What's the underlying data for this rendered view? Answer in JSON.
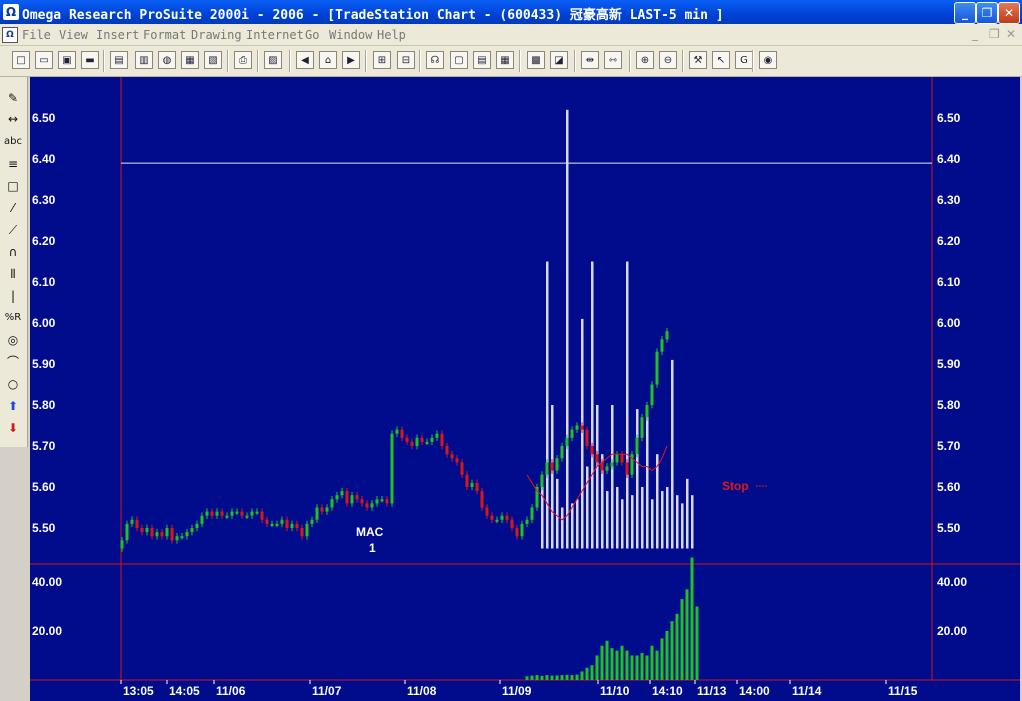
{
  "window": {
    "title": "Omega Research ProSuite 2000i - 2006 - [TradeStation Chart - (600433) 冠豪高新 LAST-5 min ]",
    "app_icon": "Ω",
    "minimize_glyph": "_",
    "maximize_glyph": "❐",
    "close_glyph": "✕"
  },
  "menu": {
    "items": [
      "File",
      "View",
      "Insert",
      "Format",
      "Drawing",
      "Internet",
      "Go",
      "Window",
      "Help"
    ],
    "mdi_minimize": "_",
    "mdi_restore": "❐",
    "mdi_close": "✕"
  },
  "toolbar_icons": [
    "new-icon",
    "open-icon",
    "save-all-icon",
    "folder-icon",
    "window-icon",
    "chart-icon",
    "globe-icon",
    "chart-analysis-icon",
    "data-icon",
    "print-icon",
    "properties-icon",
    "back-icon",
    "home-icon",
    "forward-icon",
    "insert-indicator-icon",
    "insert-study-icon",
    "expert-icon",
    "symbol-icon",
    "grid-icon",
    "table-icon",
    "bar-style-icon",
    "zoom-style-icon",
    "compress-icon",
    "expand-icon",
    "zoom-in-icon",
    "zoom-out-icon",
    "tools-icon",
    "pointer-icon",
    "goto-icon",
    "cap-icon"
  ],
  "drawing_tools": [
    {
      "name": "pencil-tool",
      "glyph": "✎"
    },
    {
      "name": "horizontal-line-tool",
      "glyph": "↔"
    },
    {
      "name": "text-tool",
      "glyph": "abc"
    },
    {
      "name": "lines-tool",
      "glyph": "≡"
    },
    {
      "name": "rectangle-tool",
      "glyph": "□"
    },
    {
      "name": "trendline-tool",
      "glyph": "⁄"
    },
    {
      "name": "fan-tool",
      "glyph": "⟋"
    },
    {
      "name": "arc-tool",
      "glyph": "∩"
    },
    {
      "name": "vertical-lines-tool",
      "glyph": "⦀"
    },
    {
      "name": "vertical-line-tool",
      "glyph": "|"
    },
    {
      "name": "percent-retracement-tool",
      "glyph": "%R"
    },
    {
      "name": "spiral-tool",
      "glyph": "◎"
    },
    {
      "name": "curve-tool",
      "glyph": "⌒"
    },
    {
      "name": "ellipse-tool",
      "glyph": "○"
    },
    {
      "name": "buy-arrow-tool",
      "glyph": "⬆"
    },
    {
      "name": "sell-arrow-tool",
      "glyph": "⬇"
    }
  ],
  "colors": {
    "chart_bg": "#000c8c",
    "axis_line": "#d21414",
    "up_bar": "#22c023",
    "down_bar": "#d81818",
    "volume": "#22c023",
    "histogram": "#d8d8f0",
    "ma_line": "#e01818",
    "hline": "#e8e8e8"
  },
  "chart_data": {
    "type": "candlestick",
    "price_axis": {
      "ticks": [
        "6.50",
        "6.40",
        "6.30",
        "6.20",
        "6.10",
        "6.00",
        "5.90",
        "5.80",
        "5.70",
        "5.60",
        "5.50"
      ],
      "ylim": [
        5.43,
        6.59
      ]
    },
    "volume_axis": {
      "ticks": [
        "40.00",
        "20.00"
      ],
      "ylim": [
        0,
        52
      ]
    },
    "time_labels": [
      "13:05",
      "14:05",
      "11/06",
      "11/07",
      "11/08",
      "11/09",
      "11/10",
      "14:10",
      "11/13",
      "14:00",
      "11/14",
      "11/15"
    ],
    "horizontal_line": 6.39,
    "annotations": [
      {
        "text": "MAC",
        "sub": "1",
        "bar": 48
      },
      {
        "text": "Stop",
        "bar": 128
      }
    ],
    "prices": [
      5.47,
      5.51,
      5.52,
      5.5,
      5.49,
      5.5,
      5.48,
      5.49,
      5.48,
      5.5,
      5.47,
      5.48,
      5.48,
      5.49,
      5.5,
      5.51,
      5.53,
      5.54,
      5.53,
      5.54,
      5.53,
      5.53,
      5.54,
      5.54,
      5.53,
      5.53,
      5.54,
      5.54,
      5.52,
      5.51,
      5.51,
      5.51,
      5.52,
      5.5,
      5.51,
      5.5,
      5.48,
      5.51,
      5.52,
      5.55,
      5.54,
      5.55,
      5.57,
      5.58,
      5.59,
      5.56,
      5.58,
      5.57,
      5.56,
      5.55,
      5.56,
      5.57,
      5.57,
      5.56,
      5.73,
      5.74,
      5.72,
      5.71,
      5.7,
      5.72,
      5.71,
      5.71,
      5.72,
      5.73,
      5.7,
      5.68,
      5.67,
      5.66,
      5.63,
      5.6,
      5.61,
      5.59,
      5.55,
      5.53,
      5.52,
      5.52,
      5.53,
      5.52,
      5.5,
      5.48,
      5.51,
      5.52,
      5.55,
      5.6,
      5.63,
      5.66,
      5.64,
      5.67,
      5.7,
      5.72,
      5.74,
      5.75,
      5.74,
      5.7,
      5.68,
      5.66,
      5.64,
      5.65,
      5.66,
      5.68,
      5.66,
      5.63,
      5.68,
      5.72,
      5.77,
      5.8,
      5.85,
      5.93,
      5.96,
      5.98
    ],
    "ma": [
      5.63,
      5.61,
      5.59,
      5.58,
      5.56,
      5.54,
      5.53,
      5.52,
      5.53,
      5.55,
      5.57,
      5.59,
      5.61,
      5.63,
      5.65,
      5.66,
      5.67,
      5.68,
      5.68,
      5.68,
      5.68,
      5.67,
      5.66,
      5.65,
      5.65,
      5.64,
      5.65,
      5.67,
      5.7
    ],
    "ma_start_bar": 81,
    "histogram": [
      0,
      0,
      0,
      5.6,
      6.15,
      5.8,
      5.62,
      5.55,
      6.52,
      5.56,
      5.57,
      6.01,
      5.65,
      6.15,
      5.8,
      5.68,
      5.59,
      5.8,
      5.6,
      5.57,
      6.15,
      5.58,
      5.79,
      5.6,
      5.8,
      5.57,
      5.68,
      5.59,
      5.6,
      5.91,
      5.58,
      5.56,
      5.62,
      5.58
    ],
    "histogram_start_bar": 81,
    "volumes": [
      0,
      0,
      0,
      0,
      0,
      0,
      0,
      0,
      0,
      0,
      0,
      0,
      0,
      0,
      0,
      0,
      0,
      0,
      0,
      0,
      0,
      0,
      0,
      0,
      0,
      0,
      0,
      0,
      0,
      0,
      0,
      0,
      0,
      0,
      0,
      0,
      0,
      0,
      0,
      0,
      0,
      0,
      0,
      0,
      0,
      0,
      0,
      0,
      0,
      0,
      0,
      0,
      0,
      0,
      0,
      0,
      0,
      0,
      0,
      0,
      0,
      0,
      0,
      0,
      0,
      0,
      0,
      0,
      0,
      0,
      0,
      0,
      0,
      0,
      0,
      0,
      0,
      0,
      0,
      0,
      0,
      1.5,
      1.8,
      2.0,
      1.7,
      2.0,
      1.8,
      1.9,
      2.0,
      2.1,
      2.0,
      2.2,
      3.5,
      5.0,
      6.0,
      10.0,
      14.0,
      16.0,
      13.0,
      12.0,
      14.0,
      12.0,
      10.0,
      10.0,
      11.0,
      10.0,
      14.0,
      12.0,
      17.0,
      20.0,
      24.0,
      27.0,
      33.0,
      37.0,
      50.0,
      30.0
    ]
  }
}
